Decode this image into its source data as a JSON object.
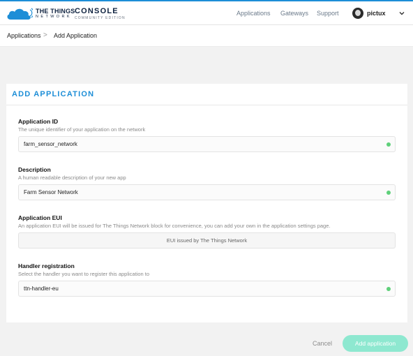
{
  "header": {
    "logo_line1": "THE THINGS",
    "logo_line2": "NETWORK",
    "console_title": "CONSOLE",
    "console_subtitle": "COMMUNITY EDITION",
    "nav": [
      "Applications",
      "Gateways",
      "Support"
    ],
    "username": "pictux"
  },
  "breadcrumb": {
    "items": [
      "Applications",
      "Add Application"
    ],
    "separator": ">"
  },
  "card": {
    "title": "ADD APPLICATION",
    "fields": [
      {
        "label": "Application ID",
        "help": "The unique identifier of your application on the network",
        "value": "farm_sensor_network",
        "valid": true
      },
      {
        "label": "Description",
        "help": "A human readable description of your new app",
        "value": "Farm Sensor Network",
        "valid": true
      },
      {
        "label": "Application EUI",
        "help": "An application EUI will be issued for The Things Network block for convenience, you can add your own in the application settings page.",
        "value": "EUI issued by The Things Network",
        "valid": false
      },
      {
        "label": "Handler registration",
        "help": "Select the handler you want to register this application to",
        "value": "ttn-handler-eu",
        "valid": true
      }
    ]
  },
  "actions": {
    "cancel_label": "Cancel",
    "submit_label": "Add application"
  },
  "colors": {
    "accent": "#1d8ed7",
    "valid": "#5fd07a",
    "primary_button": "#8ee8d0",
    "background": "#f2f2f2"
  },
  "icons": {
    "logo": "cloud-wifi-icon",
    "user_menu": "chevron-down-icon",
    "field_valid": "valid-check-icon"
  }
}
